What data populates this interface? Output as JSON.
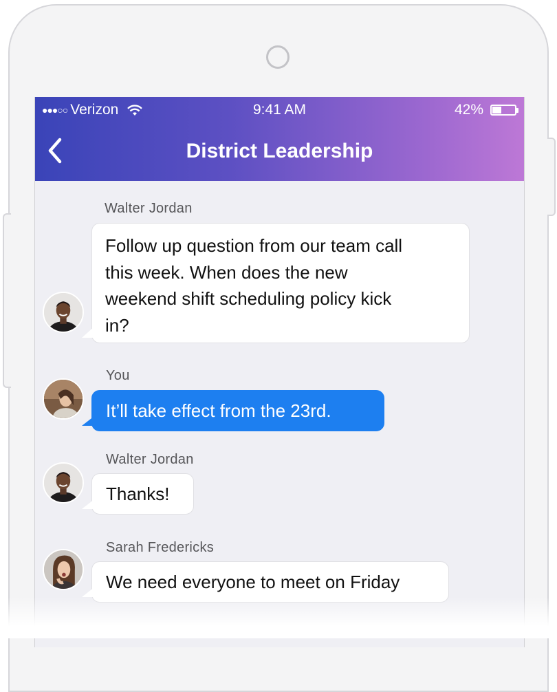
{
  "status_bar": {
    "carrier": "Verizon",
    "signal_icon": "signal-dots-icon",
    "wifi_icon": "wifi-icon",
    "time": "9:41 AM",
    "battery": "42%",
    "battery_icon": "battery-icon"
  },
  "nav": {
    "back_icon": "chevron-left-icon",
    "title": "District Leadership"
  },
  "colors": {
    "header_gradient_start": "#3a44b8",
    "header_gradient_end": "#bd78d6",
    "my_bubble": "#1d7ff0",
    "background": "#efeff4"
  },
  "messages": [
    {
      "sender": "Walter Jordan",
      "lines": [
        "Follow up question from our team call",
        "this week. When does the new",
        "weekend shift scheduling policy kick",
        "in?"
      ]
    },
    {
      "sender": "You",
      "lines": [
        "It’ll take effect from the 23rd."
      ]
    },
    {
      "sender": "Walter Jordan",
      "lines": [
        "Thanks!"
      ]
    },
    {
      "sender": "Sarah Fredericks",
      "lines": [
        "We need everyone to meet on Friday"
      ]
    }
  ]
}
